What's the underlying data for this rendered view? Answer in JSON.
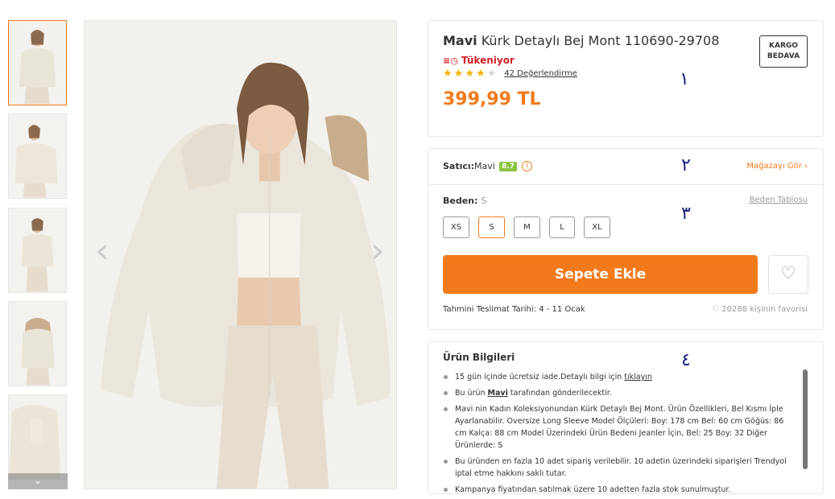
{
  "gallery": {
    "thumbnails": [
      "thumb-1",
      "thumb-2",
      "thumb-3",
      "thumb-4",
      "thumb-5"
    ],
    "scroll_down_icon": "chevron-down-icon",
    "prev_icon": "chevron-left-icon",
    "next_icon": "chevron-right-icon"
  },
  "product": {
    "brand": "Mavi",
    "name": "Kürk Detaylı Bej Mont 110690-29708",
    "stock_status": "Tükeniyor",
    "rating": 4,
    "reviews": "42 Değerlendirme",
    "price": "399,99 TL",
    "kargo_line1": "KARGO",
    "kargo_line2": "BEDAVA",
    "marker1": "١"
  },
  "seller": {
    "label": "Satıcı:",
    "name": "Mavi",
    "score": "8.7",
    "store_link": "Mağazayı Gör",
    "marker2": "٢"
  },
  "size": {
    "label": "Beden:",
    "selected": "S",
    "table_link": "Beden Tablosu",
    "options": [
      "XS",
      "S",
      "M",
      "L",
      "XL"
    ],
    "marker3": "٣"
  },
  "cart": {
    "add_label": "Sepete Ekle",
    "delivery": "Tahmini Teslimat Tarihi: 4 - 11 Ocak",
    "favorites": "20288 kişinin favorisi"
  },
  "info": {
    "title": "Ürün Bilgileri",
    "marker4": "٤",
    "item1_text": "15 gün içinde ücretsiz iade.Detaylı bilgi için ",
    "item1_link": "tıklayın",
    "item2_pre": "Bu ürün ",
    "item2_brand": "Mavi",
    "item2_post": " tarafından gönderilecektir.",
    "item3": "Mavi nin Kadın Koleksiyonundan Kürk Detaylı Bej Mont. Ürün Özellikleri, Bel Kısmı İple Ayarlanabilir. Oversize Long Sleeve Model Ölçüleri: Boy: 178 cm Bel: 60 cm Göğüs: 86 cm Kalça: 88 cm Model Üzerindeki Ürün Bedeni Jeanler İçin, Bel: 25 Boy: 32 Diğer Ürünlerde: S",
    "item4": "Bu üründen en fazla 10 adet sipariş verilebilir. 10 adetin üzerindeki siparişleri Trendyol iptal etme hakkını saklı tutar.",
    "item5": "Kampanya fiyatından satılmak üzere 10 adetten fazla stok sunulmuştur."
  }
}
